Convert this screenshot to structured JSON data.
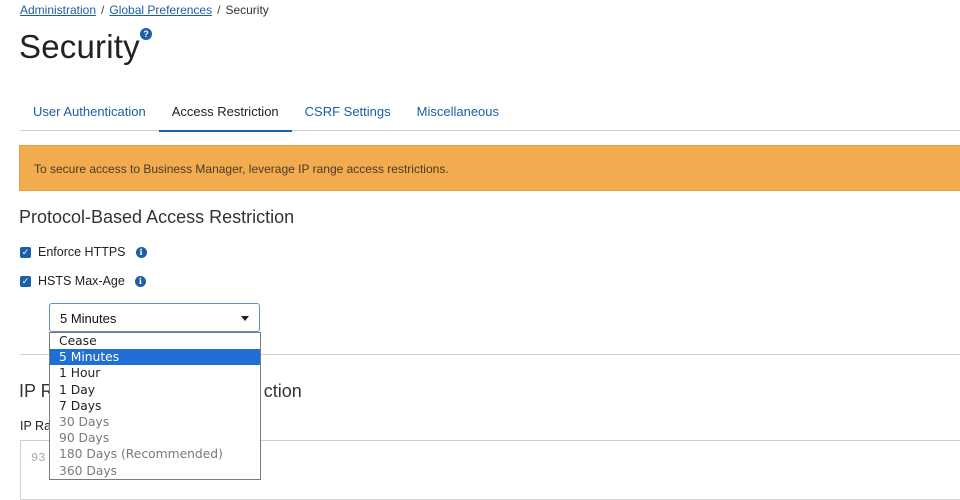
{
  "breadcrumb": {
    "items": [
      "Administration",
      "Global Preferences"
    ],
    "current": "Security",
    "separator": "/"
  },
  "page": {
    "title": "Security",
    "help_icon": "question-circle-icon"
  },
  "tabs": [
    {
      "label": "User Authentication",
      "active": false
    },
    {
      "label": "Access Restriction",
      "active": true
    },
    {
      "label": "CSRF Settings",
      "active": false
    },
    {
      "label": "Miscellaneous",
      "active": false
    }
  ],
  "alert": {
    "text": "To secure access to Business Manager, leverage IP range access restrictions.",
    "color": "#f0ac4e"
  },
  "protocol_section": {
    "title": "Protocol-Based Access Restriction",
    "enforce_https": {
      "label": "Enforce HTTPS",
      "checked": true
    },
    "hsts_max_age": {
      "label": "HSTS Max-Age",
      "checked": true
    },
    "select_value": "5 Minutes"
  },
  "dropdown_options": [
    {
      "label": "Cease",
      "state": "normal"
    },
    {
      "label": "5 Minutes",
      "state": "selected"
    },
    {
      "label": "1 Hour",
      "state": "normal"
    },
    {
      "label": "1 Day",
      "state": "normal"
    },
    {
      "label": "7 Days",
      "state": "normal"
    },
    {
      "label": "30 Days",
      "state": "dim"
    },
    {
      "label": "90 Days",
      "state": "dim"
    },
    {
      "label": "180 Days (Recommended)",
      "state": "dim"
    },
    {
      "label": "360 Days",
      "state": "dim"
    }
  ],
  "ip_section": {
    "title_left": "IP R",
    "title_right": "ction",
    "label": "IP Ra",
    "textarea_value": "93"
  },
  "colors": {
    "accent": "#1a5fa8",
    "selected_option": "#1f6fd6",
    "alert_bg": "#f0ac4e"
  }
}
